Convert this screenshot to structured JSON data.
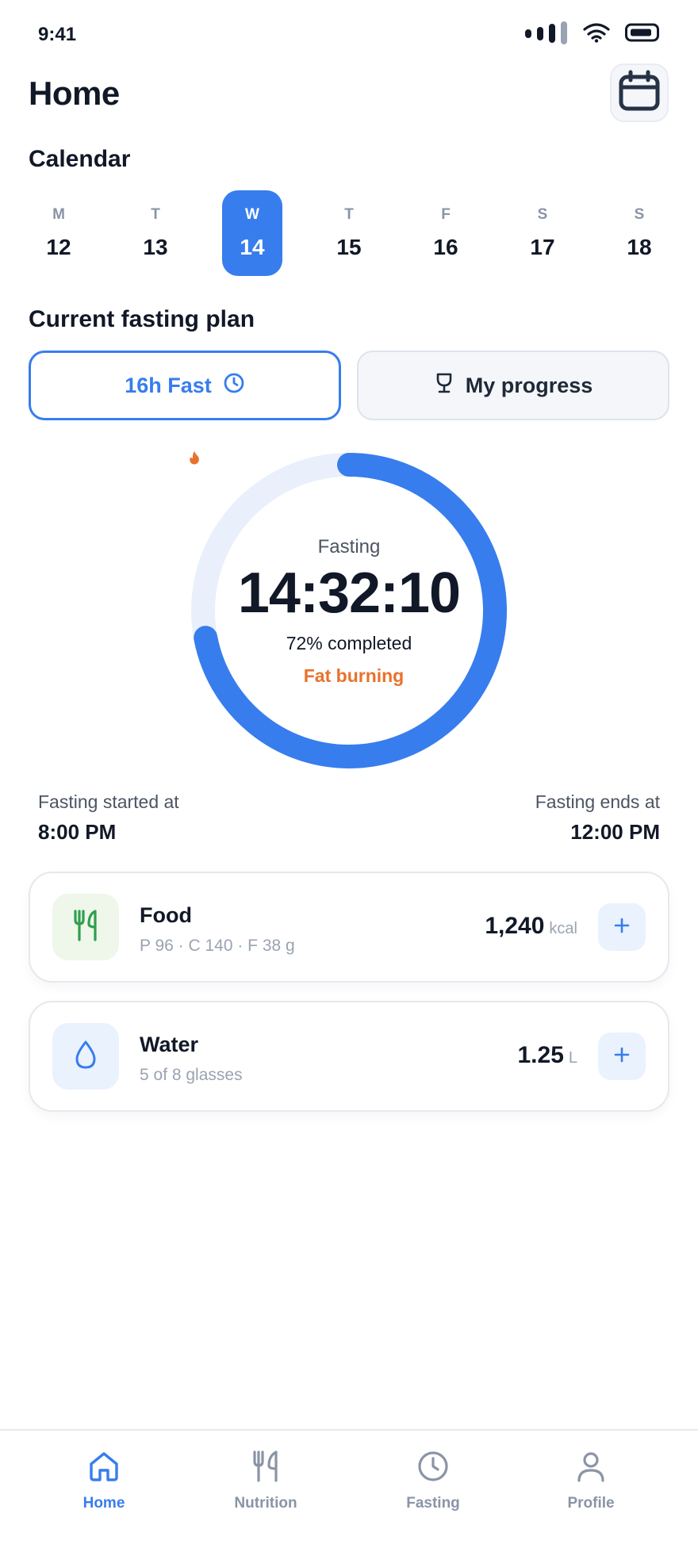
{
  "status_bar": {
    "time": "9:41",
    "icons": [
      "signal-icon",
      "wifi-icon",
      "battery-icon"
    ]
  },
  "header": {
    "title": "Home",
    "calendar_icon": "calendar-icon"
  },
  "calendar": {
    "title": "Calendar",
    "days": [
      {
        "letter": "M",
        "date": "12"
      },
      {
        "letter": "T",
        "date": "13"
      },
      {
        "letter": "W",
        "date": "14"
      },
      {
        "letter": "T",
        "date": "15"
      },
      {
        "letter": "F",
        "date": "16"
      },
      {
        "letter": "S",
        "date": "17"
      },
      {
        "letter": "S",
        "date": "18"
      }
    ],
    "selected_index": 2
  },
  "plan": {
    "title": "Current fasting plan",
    "fast_button": "16h Fast",
    "progress_button": "My progress"
  },
  "timer": {
    "label": "Fasting",
    "time": "14:32:10",
    "percent_text": "72% completed",
    "progress": 0.72,
    "phase": "Fat burning"
  },
  "times": {
    "start_label": "Fasting started at",
    "start_value": "8:00 PM",
    "end_label": "Fasting ends at",
    "end_value": "12:00 PM"
  },
  "food": {
    "title": "Food",
    "subtitle": "P 96 · C 140 · F 38 g",
    "value": "1,240",
    "unit": "kcal",
    "icon": "utensils-icon"
  },
  "water": {
    "title": "Water",
    "subtitle": "5 of 8 glasses",
    "value": "1.25",
    "unit": "L",
    "icon": "water-drop-icon"
  },
  "nav": {
    "items": [
      {
        "label": "Home",
        "icon": "home-icon"
      },
      {
        "label": "Nutrition",
        "icon": "utensils-icon"
      },
      {
        "label": "Fasting",
        "icon": "clock-icon"
      },
      {
        "label": "Profile",
        "icon": "user-icon"
      }
    ],
    "active_index": 0
  },
  "colors": {
    "accent": "#377ded",
    "ring_track": "#e9f0fb",
    "phase": "#e8722c",
    "food_icon": "#2f9e4f",
    "food_icon_bg": "#eef7ea",
    "water_icon_bg": "#eaf2fe"
  }
}
